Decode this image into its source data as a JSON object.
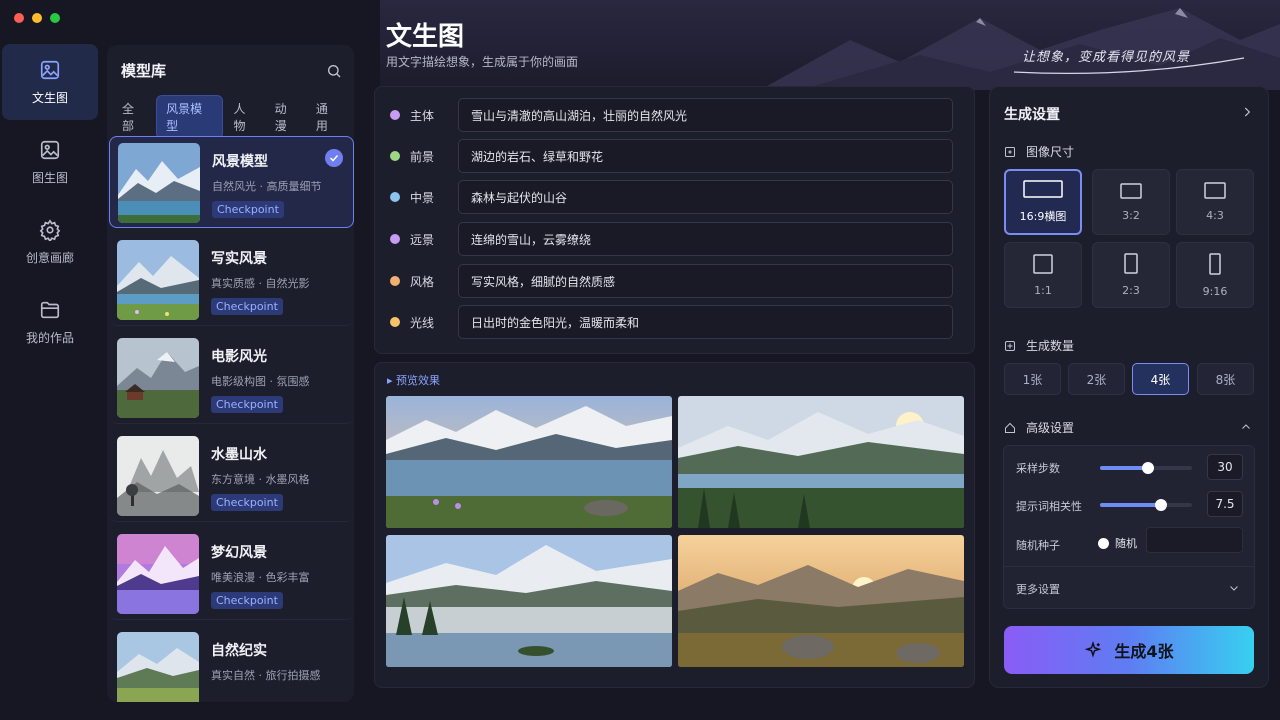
{
  "window": {
    "controls": [
      "#ff5f57",
      "#febc2e",
      "#28c840"
    ]
  },
  "nav": {
    "items": [
      {
        "label": "文生图",
        "icon": "image-icon",
        "active": true
      },
      {
        "label": "图生图",
        "icon": "image-to-image-icon",
        "active": false
      },
      {
        "label": "创意画廊",
        "icon": "gear-icon",
        "active": false
      },
      {
        "label": "我的作品",
        "icon": "folder-icon",
        "active": false
      }
    ]
  },
  "library": {
    "title": "模型库",
    "tabs": [
      "全部",
      "风景模型",
      "人物",
      "动漫",
      "通用"
    ],
    "active_tab": 1,
    "models": [
      {
        "name": "风景模型",
        "desc": "自然风光 · 高质量细节",
        "tag": "Checkpoint",
        "selected": true
      },
      {
        "name": "写实风景",
        "desc": "真实质感 · 自然光影",
        "tag": "Checkpoint",
        "selected": false
      },
      {
        "name": "电影风光",
        "desc": "电影级构图 · 氛围感",
        "tag": "Checkpoint",
        "selected": false
      },
      {
        "name": "水墨山水",
        "desc": "东方意境 · 水墨风格",
        "tag": "Checkpoint",
        "selected": false
      },
      {
        "name": "梦幻风景",
        "desc": "唯美浪漫 · 色彩丰富",
        "tag": "Checkpoint",
        "selected": false
      },
      {
        "name": "自然纪实",
        "desc": "真实自然 · 旅行拍摄感",
        "tag": "",
        "selected": false
      }
    ]
  },
  "header": {
    "title": "文生图",
    "subtitle": "用文字描绘想象，生成属于你的画面",
    "slogan": "让想象，变成看得见的风景"
  },
  "prompt": {
    "rows": [
      {
        "label": "主体",
        "value": "雪山与清澈的高山湖泊，壮丽的自然风光",
        "color": "#c89cf2"
      },
      {
        "label": "前景",
        "value": "湖边的岩石、绿草和野花",
        "color": "#9fd884"
      },
      {
        "label": "中景",
        "value": "森林与起伏的山谷",
        "color": "#8cc4f0"
      },
      {
        "label": "远景",
        "value": "连绵的雪山，云雾缭绕",
        "color": "#c89cf2"
      },
      {
        "label": "风格",
        "value": "写实风格，细腻的自然质感",
        "color": "#f0b070"
      },
      {
        "label": "光线",
        "value": "日出时的金色阳光，温暖而柔和",
        "color": "#f5c46a"
      }
    ]
  },
  "preview": {
    "label": "预览效果"
  },
  "settings": {
    "title": "生成设置",
    "size": {
      "label": "图像尺寸",
      "options": [
        "16:9横图",
        "3:2",
        "4:3",
        "1:1",
        "2:3",
        "9:16"
      ],
      "selected": 0
    },
    "count": {
      "label": "生成数量",
      "options": [
        "1张",
        "2张",
        "4张",
        "8张"
      ],
      "selected": 2
    },
    "advanced": {
      "label": "高级设置",
      "steps_label": "采样步数",
      "steps_value": "30",
      "steps_level": 0.52,
      "cfg_label": "提示词相关性",
      "cfg_value": "7.5",
      "cfg_level": 0.66,
      "seed_label": "随机种子",
      "seed_value": "随机",
      "more_label": "更多设置"
    },
    "generate_label": "生成4张"
  }
}
